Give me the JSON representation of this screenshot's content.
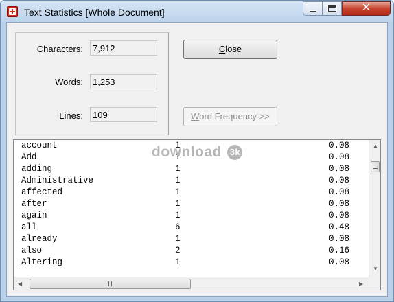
{
  "window": {
    "title": "Text Statistics [Whole Document]",
    "close_glyph": "✕"
  },
  "stats": {
    "characters": {
      "label": "Characters:",
      "value": "7,912"
    },
    "words": {
      "label": "Words:",
      "value": "1,253"
    },
    "lines": {
      "label": "Lines:",
      "value": "109"
    }
  },
  "buttons": {
    "close_prefix": "",
    "close_mnemonic": "C",
    "close_rest": "lose",
    "word_freq_prefix": "",
    "word_freq_mnemonic": "W",
    "word_freq_rest": "ord Frequency >>"
  },
  "watermark": {
    "text": "download",
    "badge": "3k"
  },
  "frequency_list": [
    {
      "word": "account",
      "count": "1",
      "pct": "0.08"
    },
    {
      "word": "Add",
      "count": "1",
      "pct": "0.08"
    },
    {
      "word": "adding",
      "count": "1",
      "pct": "0.08"
    },
    {
      "word": "Administrative",
      "count": "1",
      "pct": "0.08"
    },
    {
      "word": "affected",
      "count": "1",
      "pct": "0.08"
    },
    {
      "word": "after",
      "count": "1",
      "pct": "0.08"
    },
    {
      "word": "again",
      "count": "1",
      "pct": "0.08"
    },
    {
      "word": "all",
      "count": "6",
      "pct": "0.48"
    },
    {
      "word": "already",
      "count": "1",
      "pct": "0.08"
    },
    {
      "word": "also",
      "count": "2",
      "pct": "0.16"
    },
    {
      "word": "Altering",
      "count": "1",
      "pct": "0.08"
    }
  ],
  "scroll": {
    "up_glyph": "▲",
    "down_glyph": "▼",
    "left_glyph": "◀",
    "right_glyph": "▶"
  },
  "colors": {
    "titlebar": "#bcd3ec",
    "close_button": "#c7422e",
    "client": "#f0f0f0"
  }
}
